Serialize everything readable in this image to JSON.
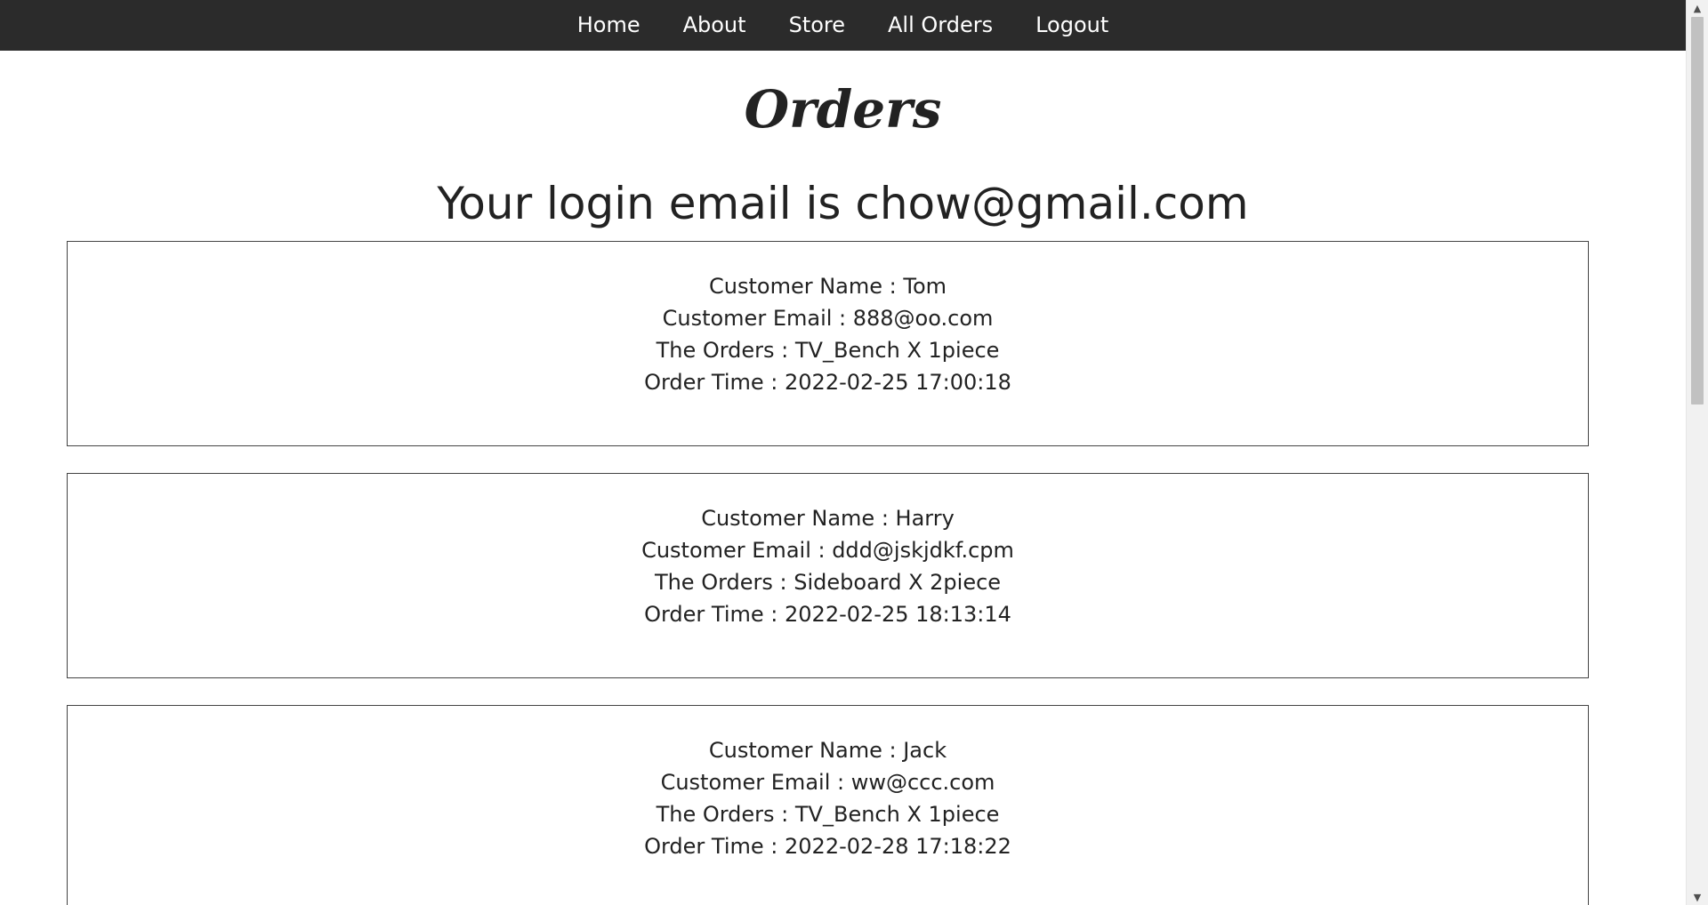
{
  "nav": {
    "items": [
      {
        "label": "Home"
      },
      {
        "label": "About"
      },
      {
        "label": "Store"
      },
      {
        "label": "All Orders"
      },
      {
        "label": "Logout"
      }
    ]
  },
  "page": {
    "title": "Orders",
    "login_text": "Your login email is chow@gmail.com"
  },
  "orders": [
    {
      "name_line": "Customer Name : Tom",
      "email_line": "Customer Email : 888@oo.com",
      "orders_line": "The Orders : TV_Bench X 1piece",
      "time_line": "Order Time : 2022-02-25 17:00:18"
    },
    {
      "name_line": "Customer Name : Harry",
      "email_line": "Customer Email : ddd@jskjdkf.cpm",
      "orders_line": "The Orders : Sideboard X 2piece",
      "time_line": "Order Time : 2022-02-25 18:13:14"
    },
    {
      "name_line": "Customer Name : Jack",
      "email_line": "Customer Email : ww@ccc.com",
      "orders_line": "The Orders : TV_Bench X 1piece",
      "time_line": "Order Time : 2022-02-28 17:18:22"
    }
  ],
  "scrollbar": {
    "up_icon": "triangle-up-icon",
    "down_icon": "triangle-down-icon"
  },
  "colors": {
    "navbar_bg": "#2b2b2b",
    "nav_text": "#ffffff",
    "text": "#222222",
    "card_border": "#444444"
  }
}
